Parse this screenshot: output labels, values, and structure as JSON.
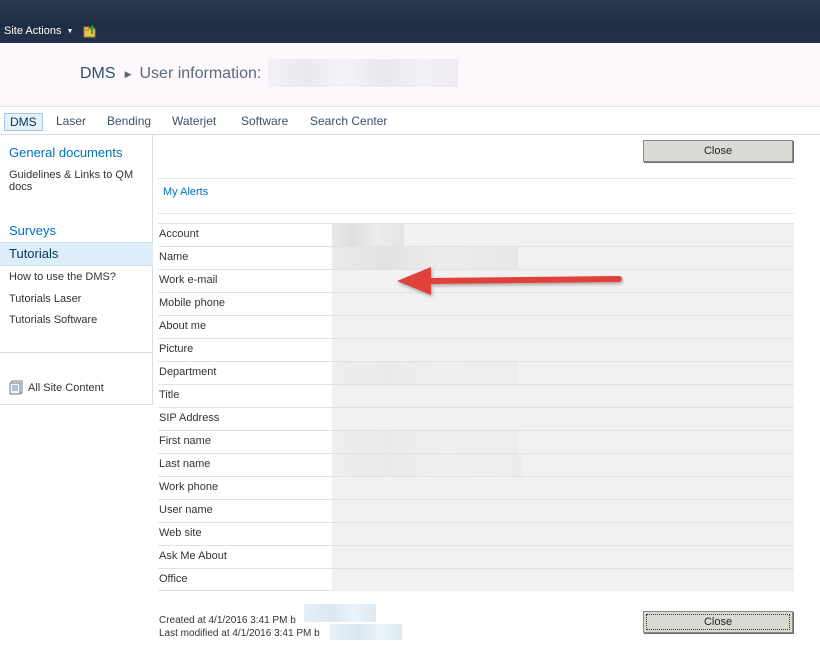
{
  "ribbon": {
    "site_actions_label": "Site Actions",
    "navigate_up_icon": "navigate-up-icon"
  },
  "title_area": {
    "breadcrumb_root": "DMS",
    "separator_icon": "breadcrumb-arrow-icon",
    "page_title": "User information:"
  },
  "top_nav": {
    "tabs": [
      {
        "label": "DMS",
        "selected": true
      },
      {
        "label": "Laser"
      },
      {
        "label": "Bending"
      },
      {
        "label": "Waterjet"
      },
      {
        "label": "Software"
      },
      {
        "label": "Search Center"
      }
    ]
  },
  "left_nav": {
    "general_documents": "General documents",
    "guidelines_links": "Guidelines & Links to QM docs",
    "surveys": "Surveys",
    "tutorials": "Tutorials",
    "how_to_use": "How to use the DMS?",
    "tutorials_laser": "Tutorials Laser",
    "tutorials_software": "Tutorials Software",
    "all_site_content": "All Site Content"
  },
  "actions": {
    "close_top": "Close",
    "close_bottom": "Close",
    "my_alerts": "My Alerts"
  },
  "fields": [
    {
      "label": "Account"
    },
    {
      "label": "Name"
    },
    {
      "label": "Work e-mail"
    },
    {
      "label": "Mobile phone"
    },
    {
      "label": "About me"
    },
    {
      "label": "Picture"
    },
    {
      "label": "Department"
    },
    {
      "label": "Title"
    },
    {
      "label": "SIP Address"
    },
    {
      "label": "First name"
    },
    {
      "label": "Last name"
    },
    {
      "label": "Work phone"
    },
    {
      "label": "User name"
    },
    {
      "label": "Web site"
    },
    {
      "label": "Ask Me About"
    },
    {
      "label": "Office"
    }
  ],
  "footer": {
    "created": "Created at 4/1/2016 3:41 PM b",
    "modified": "Last modified at 4/1/2016 3:41 PM b"
  },
  "colors": {
    "annotation_arrow": "#e0423b",
    "link_blue": "#0072bc",
    "ribbon_dark": "#22324a"
  }
}
